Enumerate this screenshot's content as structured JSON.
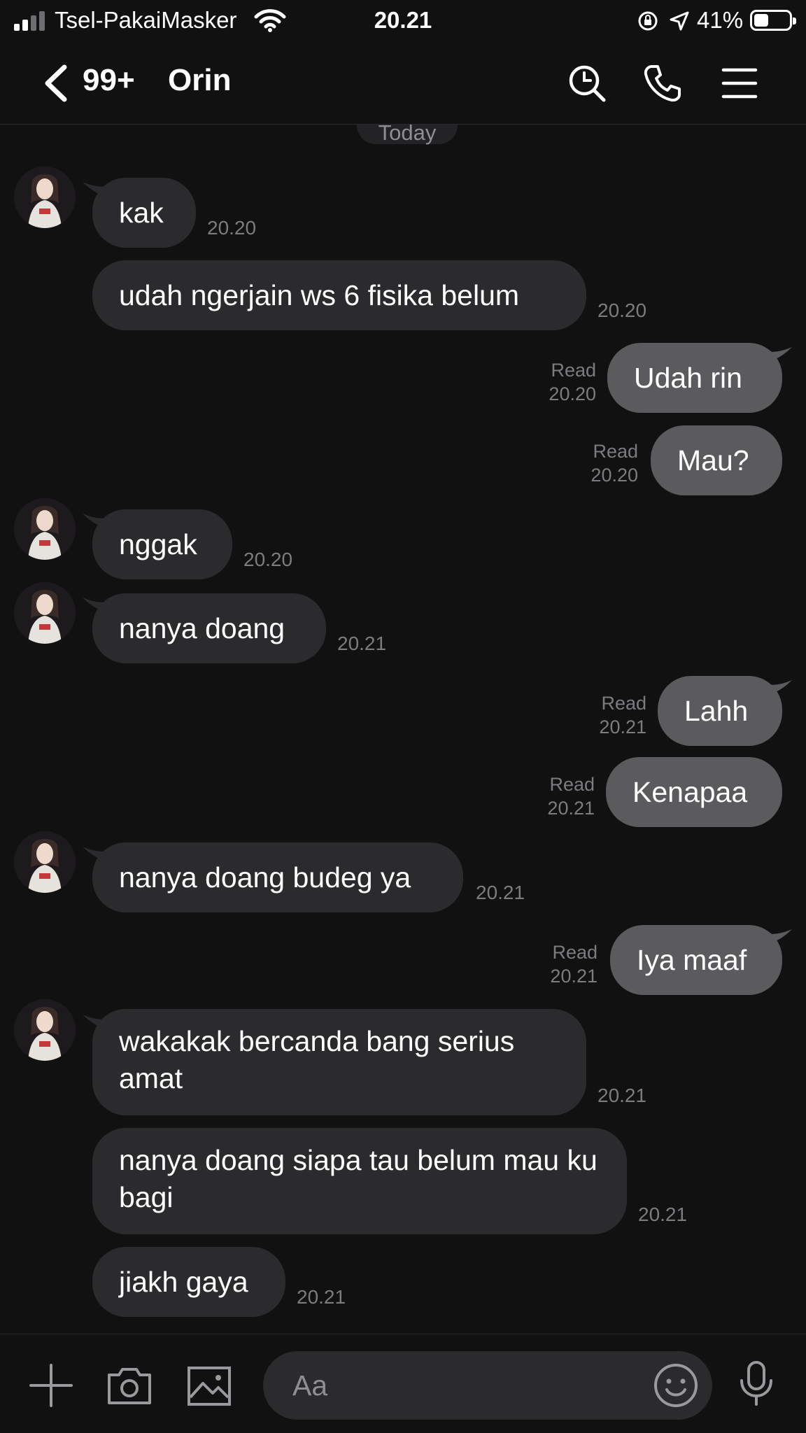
{
  "status_bar": {
    "carrier": "Tsel-PakaiMasker",
    "time": "20.21",
    "battery_percent": "41%",
    "icons": [
      "signal-icon",
      "wifi-icon",
      "rotation-lock-icon",
      "location-arrow-icon",
      "battery-icon"
    ]
  },
  "header": {
    "unread_count": "99+",
    "title": "Orin",
    "icons": [
      "back-chevron-icon",
      "search-icon",
      "phone-icon",
      "menu-icon"
    ]
  },
  "chat": {
    "date_separator": "Today",
    "messages": [
      {
        "side": "in",
        "text": "kak",
        "time": "20.20"
      },
      {
        "side": "in",
        "text": "udah ngerjain ws 6 fisika belum",
        "time": "20.20"
      },
      {
        "side": "out",
        "text": "Udah rin",
        "status": "Read",
        "time": "20.20"
      },
      {
        "side": "out",
        "text": "Mau?",
        "status": "Read",
        "time": "20.20"
      },
      {
        "side": "in",
        "text": "nggak",
        "time": "20.20"
      },
      {
        "side": "in",
        "text": "nanya doang",
        "time": "20.21"
      },
      {
        "side": "out",
        "text": "Lahh",
        "status": "Read",
        "time": "20.21"
      },
      {
        "side": "out",
        "text": "Kenapaa",
        "status": "Read",
        "time": "20.21"
      },
      {
        "side": "in",
        "text": "nanya doang budeg ya",
        "time": "20.21"
      },
      {
        "side": "out",
        "text": "Iya maaf",
        "status": "Read",
        "time": "20.21"
      },
      {
        "side": "in",
        "text": "wakakak bercanda bang serius amat",
        "time": "20.21"
      },
      {
        "side": "in",
        "text": "nanya doang siapa tau belum mau ku bagi",
        "time": "20.21"
      },
      {
        "side": "in",
        "text": "jiakh gaya",
        "time": "20.21"
      }
    ]
  },
  "input_bar": {
    "placeholder": "Aa",
    "icons": [
      "plus-icon",
      "camera-icon",
      "image-icon",
      "emoji-icon",
      "microphone-icon"
    ]
  },
  "colors": {
    "background": "#111112",
    "incoming_bubble": "#2b2b2d",
    "outgoing_bubble": "#5b5b5e",
    "meta_text": "#7c7c80"
  }
}
